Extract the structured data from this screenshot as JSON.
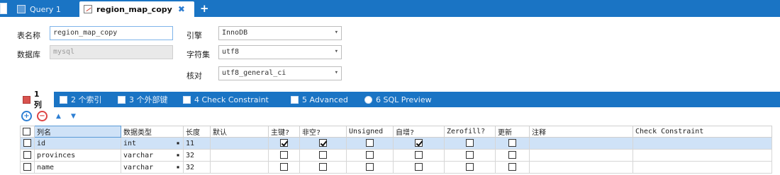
{
  "tabs": [
    {
      "label": "Query 1",
      "icon": "query-icon",
      "active": false
    },
    {
      "label": "region_map_copy",
      "icon": "table-design-icon",
      "active": true
    }
  ],
  "properties": {
    "table_name_label": "表名称",
    "table_name_value": "region_map_copy",
    "database_label": "数据库",
    "database_value": "mysql",
    "engine_label": "引擎",
    "engine_value": "InnoDB",
    "charset_label": "字符集",
    "charset_value": "utf8",
    "collation_label": "核对",
    "collation_value": "utf8_general_ci"
  },
  "subtabs": [
    {
      "label": "1 列",
      "active": true
    },
    {
      "label": "2 个索引",
      "active": false
    },
    {
      "label": "3 个外部键",
      "active": false
    },
    {
      "label": "4 Check Constraint",
      "active": false
    },
    {
      "label": "5 Advanced",
      "active": false
    },
    {
      "label": "6 SQL Preview",
      "active": false
    }
  ],
  "toolbar": {
    "add": "+",
    "remove": "−",
    "up": "▲",
    "down": "▼"
  },
  "grid": {
    "headers": [
      "列名",
      "数据类型",
      "长度",
      "默认",
      "主键?",
      "非空?",
      "Unsigned",
      "自增?",
      "Zerofill?",
      "更新",
      "注释",
      "Check Constraint"
    ],
    "rows": [
      {
        "name": "id",
        "type": "int",
        "length": "11",
        "default": "",
        "pk": true,
        "notnull": true,
        "unsigned": false,
        "autoinc": true,
        "zerofill": false,
        "update": false,
        "comment": "",
        "check": ""
      },
      {
        "name": "provinces",
        "type": "varchar",
        "length": "32",
        "default": "",
        "pk": false,
        "notnull": false,
        "unsigned": false,
        "autoinc": false,
        "zerofill": false,
        "update": false,
        "comment": "",
        "check": ""
      },
      {
        "name": "name",
        "type": "varchar",
        "length": "32",
        "default": "",
        "pk": false,
        "notnull": false,
        "unsigned": false,
        "autoinc": false,
        "zerofill": false,
        "update": false,
        "comment": "",
        "check": ""
      }
    ]
  },
  "colors": {
    "accent": "#1a74c4",
    "selection": "#cfe2f7"
  }
}
